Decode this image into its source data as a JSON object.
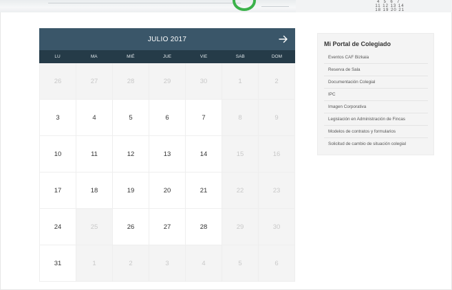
{
  "banner": {
    "numbers": "   4  5  6  7\n  11 12 13 14\n  18 19 20 21"
  },
  "calendar": {
    "title": "JULIO 2017",
    "next_icon": "arrow-right-icon",
    "weekdays": [
      "LU",
      "MA",
      "MIÉ",
      "JUE",
      "VIE",
      "SAB",
      "DOM"
    ],
    "weeks": [
      [
        {
          "d": "26",
          "m": true
        },
        {
          "d": "27",
          "m": true
        },
        {
          "d": "28",
          "m": true
        },
        {
          "d": "29",
          "m": true
        },
        {
          "d": "30",
          "m": true
        },
        {
          "d": "1",
          "m": true
        },
        {
          "d": "2",
          "m": true
        }
      ],
      [
        {
          "d": "3",
          "m": false
        },
        {
          "d": "4",
          "m": false
        },
        {
          "d": "5",
          "m": false
        },
        {
          "d": "6",
          "m": false
        },
        {
          "d": "7",
          "m": false
        },
        {
          "d": "8",
          "m": true
        },
        {
          "d": "9",
          "m": true
        }
      ],
      [
        {
          "d": "10",
          "m": false
        },
        {
          "d": "11",
          "m": false
        },
        {
          "d": "12",
          "m": false
        },
        {
          "d": "13",
          "m": false
        },
        {
          "d": "14",
          "m": false
        },
        {
          "d": "15",
          "m": true
        },
        {
          "d": "16",
          "m": true
        }
      ],
      [
        {
          "d": "17",
          "m": false
        },
        {
          "d": "18",
          "m": false
        },
        {
          "d": "19",
          "m": false
        },
        {
          "d": "20",
          "m": false
        },
        {
          "d": "21",
          "m": false
        },
        {
          "d": "22",
          "m": true
        },
        {
          "d": "23",
          "m": true
        }
      ],
      [
        {
          "d": "24",
          "m": false
        },
        {
          "d": "25",
          "m": true
        },
        {
          "d": "26",
          "m": false
        },
        {
          "d": "27",
          "m": false
        },
        {
          "d": "28",
          "m": false
        },
        {
          "d": "29",
          "m": true
        },
        {
          "d": "30",
          "m": true
        }
      ],
      [
        {
          "d": "31",
          "m": false
        },
        {
          "d": "1",
          "m": true
        },
        {
          "d": "2",
          "m": true
        },
        {
          "d": "3",
          "m": true
        },
        {
          "d": "4",
          "m": true
        },
        {
          "d": "5",
          "m": true
        },
        {
          "d": "6",
          "m": true
        }
      ]
    ]
  },
  "sidebar": {
    "title": "Mi Portal de Colegiado",
    "items": [
      "Eventos CAF Bizkaia",
      "Reserva de Sala",
      "Documentación Colegial",
      "IPC",
      "Imagen Corporativa",
      "Legislación en Administración de Fincas",
      "Modelos de contratos y formularios",
      "Solicitud de cambio de situación colegial"
    ]
  }
}
